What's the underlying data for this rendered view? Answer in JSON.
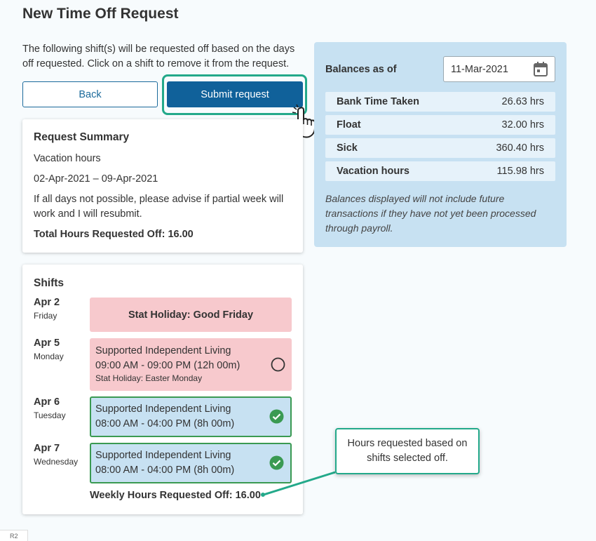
{
  "page": {
    "title": "New Time Off Request",
    "intro": "The following shift(s) will be requested off based on the days off requested. Click on a shift to remove it from the request.",
    "back_label": "Back",
    "submit_label": "Submit request"
  },
  "summary": {
    "heading": "Request Summary",
    "type": "Vacation hours",
    "dates": "02-Apr-2021 – 09-Apr-2021",
    "comment": "If all days not possible, please advise if partial week will work and I will resubmit.",
    "total": "Total Hours Requested Off: 16.00"
  },
  "balances": {
    "title": "Balances as of",
    "date": "11-Mar-2021",
    "rows": [
      {
        "label": "Bank Time Taken",
        "value": "26.63 hrs"
      },
      {
        "label": "Float",
        "value": "32.00 hrs"
      },
      {
        "label": "Sick",
        "value": "360.40 hrs"
      },
      {
        "label": "Vacation hours",
        "value": "115.98 hrs"
      }
    ],
    "note": "Balances displayed will not include future transactions if they have not yet been processed through payroll."
  },
  "shifts": {
    "heading": "Shifts",
    "days": [
      {
        "date": "Apr 2",
        "weekday": "Friday",
        "holiday": "Stat Holiday: Good Friday"
      },
      {
        "date": "Apr 5",
        "weekday": "Monday",
        "name": "Supported Independent Living",
        "time": "09:00 AM - 09:00 PM (12h 00m)",
        "note": "Stat Holiday: Easter Monday",
        "selected": false
      },
      {
        "date": "Apr 6",
        "weekday": "Tuesday",
        "name": "Supported Independent Living",
        "time": "08:00 AM - 04:00 PM (8h 00m)",
        "selected": true
      },
      {
        "date": "Apr 7",
        "weekday": "Wednesday",
        "name": "Supported Independent Living",
        "time": "08:00 AM - 04:00 PM (8h 00m)",
        "selected": true
      }
    ],
    "weekly_total": "Weekly Hours Requested Off: 16.00"
  },
  "callout": {
    "text": "Hours requested based on shifts selected off."
  },
  "footer_tag": "R2",
  "colors": {
    "primary": "#10619a",
    "accent_teal": "#23a98a",
    "balance_panel": "#c7e1f2",
    "holiday_red": "#f7c9cd",
    "check_green": "#3a9a52"
  },
  "icons": [
    "calendar-icon",
    "pointer-hand-icon",
    "unchecked-circle-icon",
    "check-circle-icon"
  ]
}
